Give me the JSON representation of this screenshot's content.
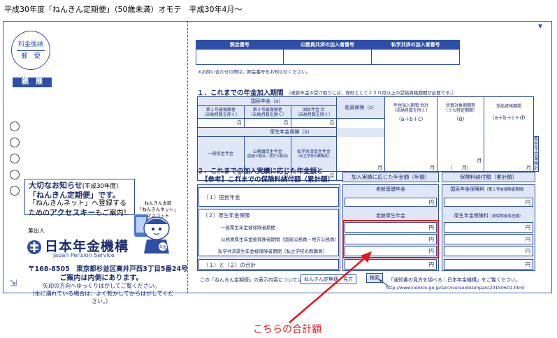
{
  "header": "平成30年度「ねんきん定期便」（50歳未満）オモテ　平成30年4月～",
  "stamp": {
    "line1": "料金後納",
    "line2": "郵　便"
  },
  "kyohan": "親　展",
  "notice": {
    "line1_em": "大切なお知らせ",
    "line1_sm": "(平成30年度)",
    "line2": "「ねんきん定期便」です。",
    "line3": "「ねんきんネット」へ登録する",
    "line4_pre": "ための",
    "line4_em": "アクセスキー",
    "line4_post": "もご案内！"
  },
  "mascot_label": {
    "line1": "ねんきん太郎",
    "line2": "「ねんきんネット」マスコット",
    "badge": "年金"
  },
  "sender_label": "差出人",
  "logo": {
    "jp": "日本年金機構",
    "en": "Japan Pension Service"
  },
  "address": "〒168-8505　東京都杉並区高井戸西3丁目5番24号",
  "notice2": {
    "title": "ご案内は内側にあります。",
    "line1": "矢印の方向へゆっくりはがしてご覧ください。",
    "line2": "（水に濡れている場合は、よく乾かしてからはがしてください。）"
  },
  "top_table": {
    "col1": "照会番号",
    "col2": "公務員共済の加入者番号",
    "col3": "私学共済の加入者番号",
    "note": "※お問い合わせの際は、照会番号をお知らせください。"
  },
  "section1": {
    "title": "１．これまでの年金加入期間",
    "note": "（老齢年金の受け取りには、原則として１２０月以上の受給資格期間が必要です。）",
    "kokumin_header": "国民年金（a）",
    "k1": "第１号被保険者",
    "k1_sub": "（未納月数を除く）",
    "k3": "第３号被保険者",
    "k3_sub": "（未納月数を除く）",
    "ksum": "国民年金 計",
    "ksum_sub": "（未納月数を除く）",
    "sen": "船員保険（c）",
    "total": "年金加入期間 合計",
    "total_sub": "（未納月数を除く）",
    "total_formula": "（a＋b＋c）",
    "godo": "合算対象期間等",
    "godo_sub": "（うち特定期間）",
    "godo_d": "（d）",
    "jukyu": "受給資格期間",
    "jukyu_formula": "（a＋b＋c＋d）",
    "kosei_header": "厚生年金保険（b）",
    "b1": "一般厚生年金",
    "b2": "公務員厚生年金",
    "b2_sub": "(国家公務員・地方公務員)",
    "b3": "私学共済厚生年金",
    "b3_sub": "(私立学校の教職員)",
    "bsum": "厚生年金保険 計",
    "unit": "月",
    "paren_l": "（",
    "paren_r": "）"
  },
  "section2": {
    "title1": "２．これまでの加入実績に応じた年金額と",
    "title2": "【参考】これまでの保険料納付額（累計額）",
    "col_nenkin": "加入実績に応じた年金額（年額）",
    "col_hoken": "保険料納付額（累計額）",
    "r1": "（１）国民年金",
    "roukiso": "老齢基礎年金",
    "kokumin_hoken": "国民年金保険料",
    "kokumin_hoken_sub": "（第１号被保険者期間）",
    "r2": "（２）厚生年金保険",
    "roukosei": "老齢厚生年金",
    "kosei_hoken": "厚生年金保険料",
    "kosei_hoken_sub": "（被保険者負担額）",
    "s1": "一般厚生年金被保険者期間",
    "s2": "公務員厚生年金被保険者期間（国家公務員・地方公務員）",
    "s3": "私学共済厚生年金被保険者期間（私立学校の教職員）",
    "r3": "（１）と（２）の合計",
    "yen": "円"
  },
  "bottom": {
    "pre": "この「ねんきん定期便」の表示内容については、",
    "search_term": "ねんきん定期便　見方",
    "search_btn": "検索",
    "post": "「通知書の見方を調べる｜日本年金機構」をご覧ください。",
    "url": "http://www.nenkin.go.jp/service/seidozenpan/20150601.html"
  },
  "callout": "こちらの合計額",
  "colors": {
    "blue": "#2d4fa8",
    "red": "#e3161b",
    "light": "#dfe7f7"
  }
}
